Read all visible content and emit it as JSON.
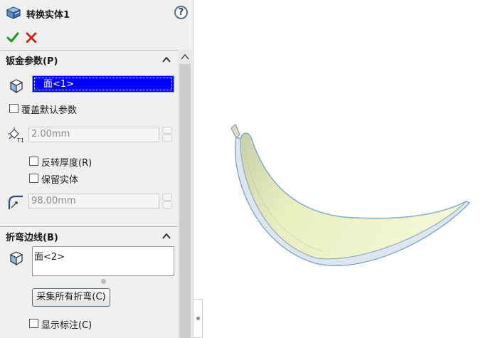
{
  "window": {
    "title": "转换实体1"
  },
  "icons": {
    "title": "sheetmetal-convert-icon",
    "help": "help-icon",
    "ok": "checkmark-icon",
    "cancel": "close-icon"
  },
  "help_glyph": "?",
  "groups": {
    "sheetmetal_params": {
      "title": "钣金参数(P)",
      "fixed_face_value": "面<1>",
      "override_defaults_label": "覆盖默认参数",
      "thickness_value": "2.00mm",
      "reverse_thickness_label": "反转厚度(R)",
      "keep_body_label": "保留实体",
      "bend_radius_value": "98.00mm"
    },
    "bend_edges": {
      "title": "折弯边线(B)",
      "selection_value": "面<2>",
      "collect_button_label": "采集所有折弯(C)",
      "show_callouts_label": "显示标注(C)"
    }
  },
  "colors": {
    "selection_active": "#0000ff",
    "panel_bg": "#f0f0f0",
    "model_face": "#eef3c8",
    "model_edge": "#6e9cc4",
    "ok_green": "#1e9b1e",
    "cancel_red": "#d22020"
  }
}
